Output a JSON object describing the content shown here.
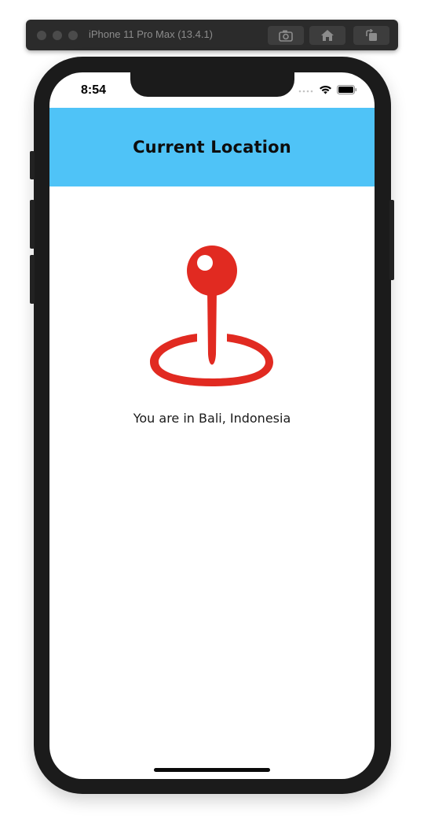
{
  "simulator": {
    "title": "iPhone 11 Pro Max (13.4.1)",
    "buttons": [
      "screenshot-icon",
      "home-icon",
      "rotate-icon"
    ]
  },
  "status_bar": {
    "time": "8:54"
  },
  "navbar": {
    "title": "Current Location",
    "color": "#4fc3f7"
  },
  "content": {
    "pin_icon": "location-pin-icon",
    "pin_color": "#e12a21",
    "location_text": "You are in Bali, Indonesia"
  }
}
